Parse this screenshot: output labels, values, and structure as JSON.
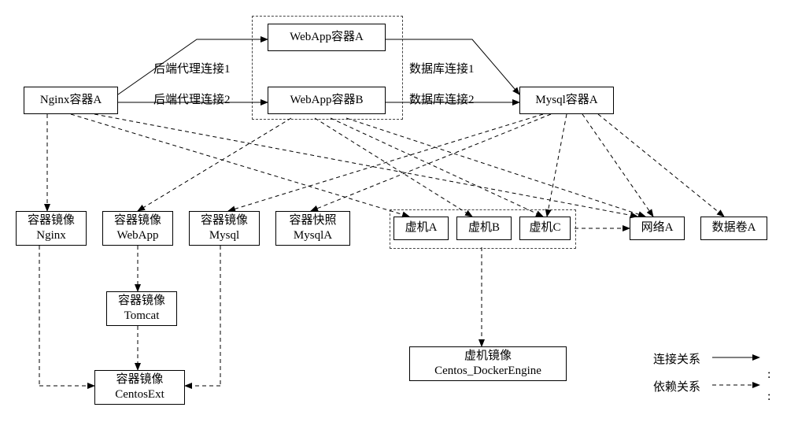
{
  "nodes": {
    "nginxA": "Nginx容器A",
    "webappA": "WebApp容器A",
    "webappB": "WebApp容器B",
    "mysqlA": "Mysql容器A",
    "imgNginx": "容器镜像\nNginx",
    "imgWebApp": "容器镜像\nWebApp",
    "imgMysql": "容器镜像\nMysql",
    "snapMysqlA": "容器快照\nMysqlA",
    "vmA": "虚机A",
    "vmB": "虚机B",
    "vmC": "虚机C",
    "netA": "网络A",
    "volA": "数据卷A",
    "imgTomcat": "容器镜像\nTomcat",
    "imgCentosExt": "容器镜像\nCentosExt",
    "vmImg": "虚机镜像\nCentos_DockerEngine"
  },
  "edges": {
    "proxy1": "后端代理连接1",
    "proxy2": "后端代理连接2",
    "db1": "数据库连接1",
    "db2": "数据库连接2"
  },
  "legend": {
    "conn": "连接关系",
    "dep": "依赖关系"
  }
}
